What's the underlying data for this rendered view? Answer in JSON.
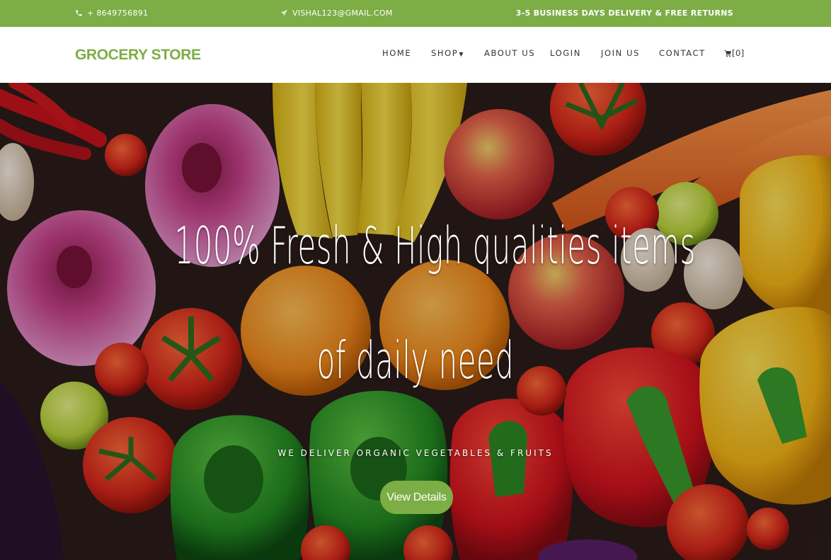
{
  "topbar": {
    "phone": "+ 8649756891",
    "email": "VISHAL123@GMAIL.COM",
    "delivery": "3-5 BUSINESS DAYS DELIVERY & FREE RETURNS",
    "phone_icon": "phone-icon",
    "email_icon": "paper-plane-icon",
    "background": "#7dad45"
  },
  "brand": {
    "name": "GROCERY STORE",
    "color": "#7dad45"
  },
  "nav": {
    "home": "HOME",
    "shop": "SHOP",
    "about": "ABOUT US",
    "login": "LOGIN",
    "join": "JOIN US",
    "contact": "CONTACT",
    "cart_count": "[0]",
    "cart_icon": "cart-icon"
  },
  "hero": {
    "title_line1": "100% Fresh & High qualities items",
    "title_line2": "of daily need",
    "subtitle": "WE DELIVER ORGANIC VEGETABLES & FRUITS",
    "button": "View Details",
    "button_color": "#7dad45"
  }
}
